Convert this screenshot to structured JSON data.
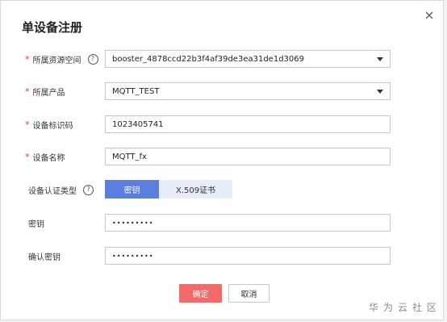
{
  "dialog": {
    "title": "单设备注册",
    "close_icon": "close-icon"
  },
  "form": {
    "resource_space": {
      "label": "所属资源空间",
      "required": true,
      "value": "booster_4878ccd22b3f4af39de3ea31de1d3069",
      "has_help": true
    },
    "product": {
      "label": "所属产品",
      "required": true,
      "value": "MQTT_TEST"
    },
    "device_id": {
      "label": "设备标识码",
      "required": true,
      "value": "1023405741"
    },
    "device_name": {
      "label": "设备名称",
      "required": true,
      "value": "MQTT_fx"
    },
    "auth_type": {
      "label": "设备认证类型",
      "required": false,
      "has_help": true,
      "options": [
        "密钥",
        "X.509证书"
      ],
      "selected": "密钥"
    },
    "secret": {
      "label": "密钥",
      "value": "•••••••••"
    },
    "confirm_secret": {
      "label": "确认密钥",
      "value": "•••••••••"
    }
  },
  "help_glyph": "?",
  "required_mark": "*",
  "buttons": {
    "confirm": "确定",
    "cancel": "取消"
  },
  "watermark": "华为云社区",
  "colors": {
    "primary": "#5b7fe0",
    "confirm": "#f26b6b",
    "required": "#e4393c",
    "segment_inactive": "#e6ecf8"
  }
}
